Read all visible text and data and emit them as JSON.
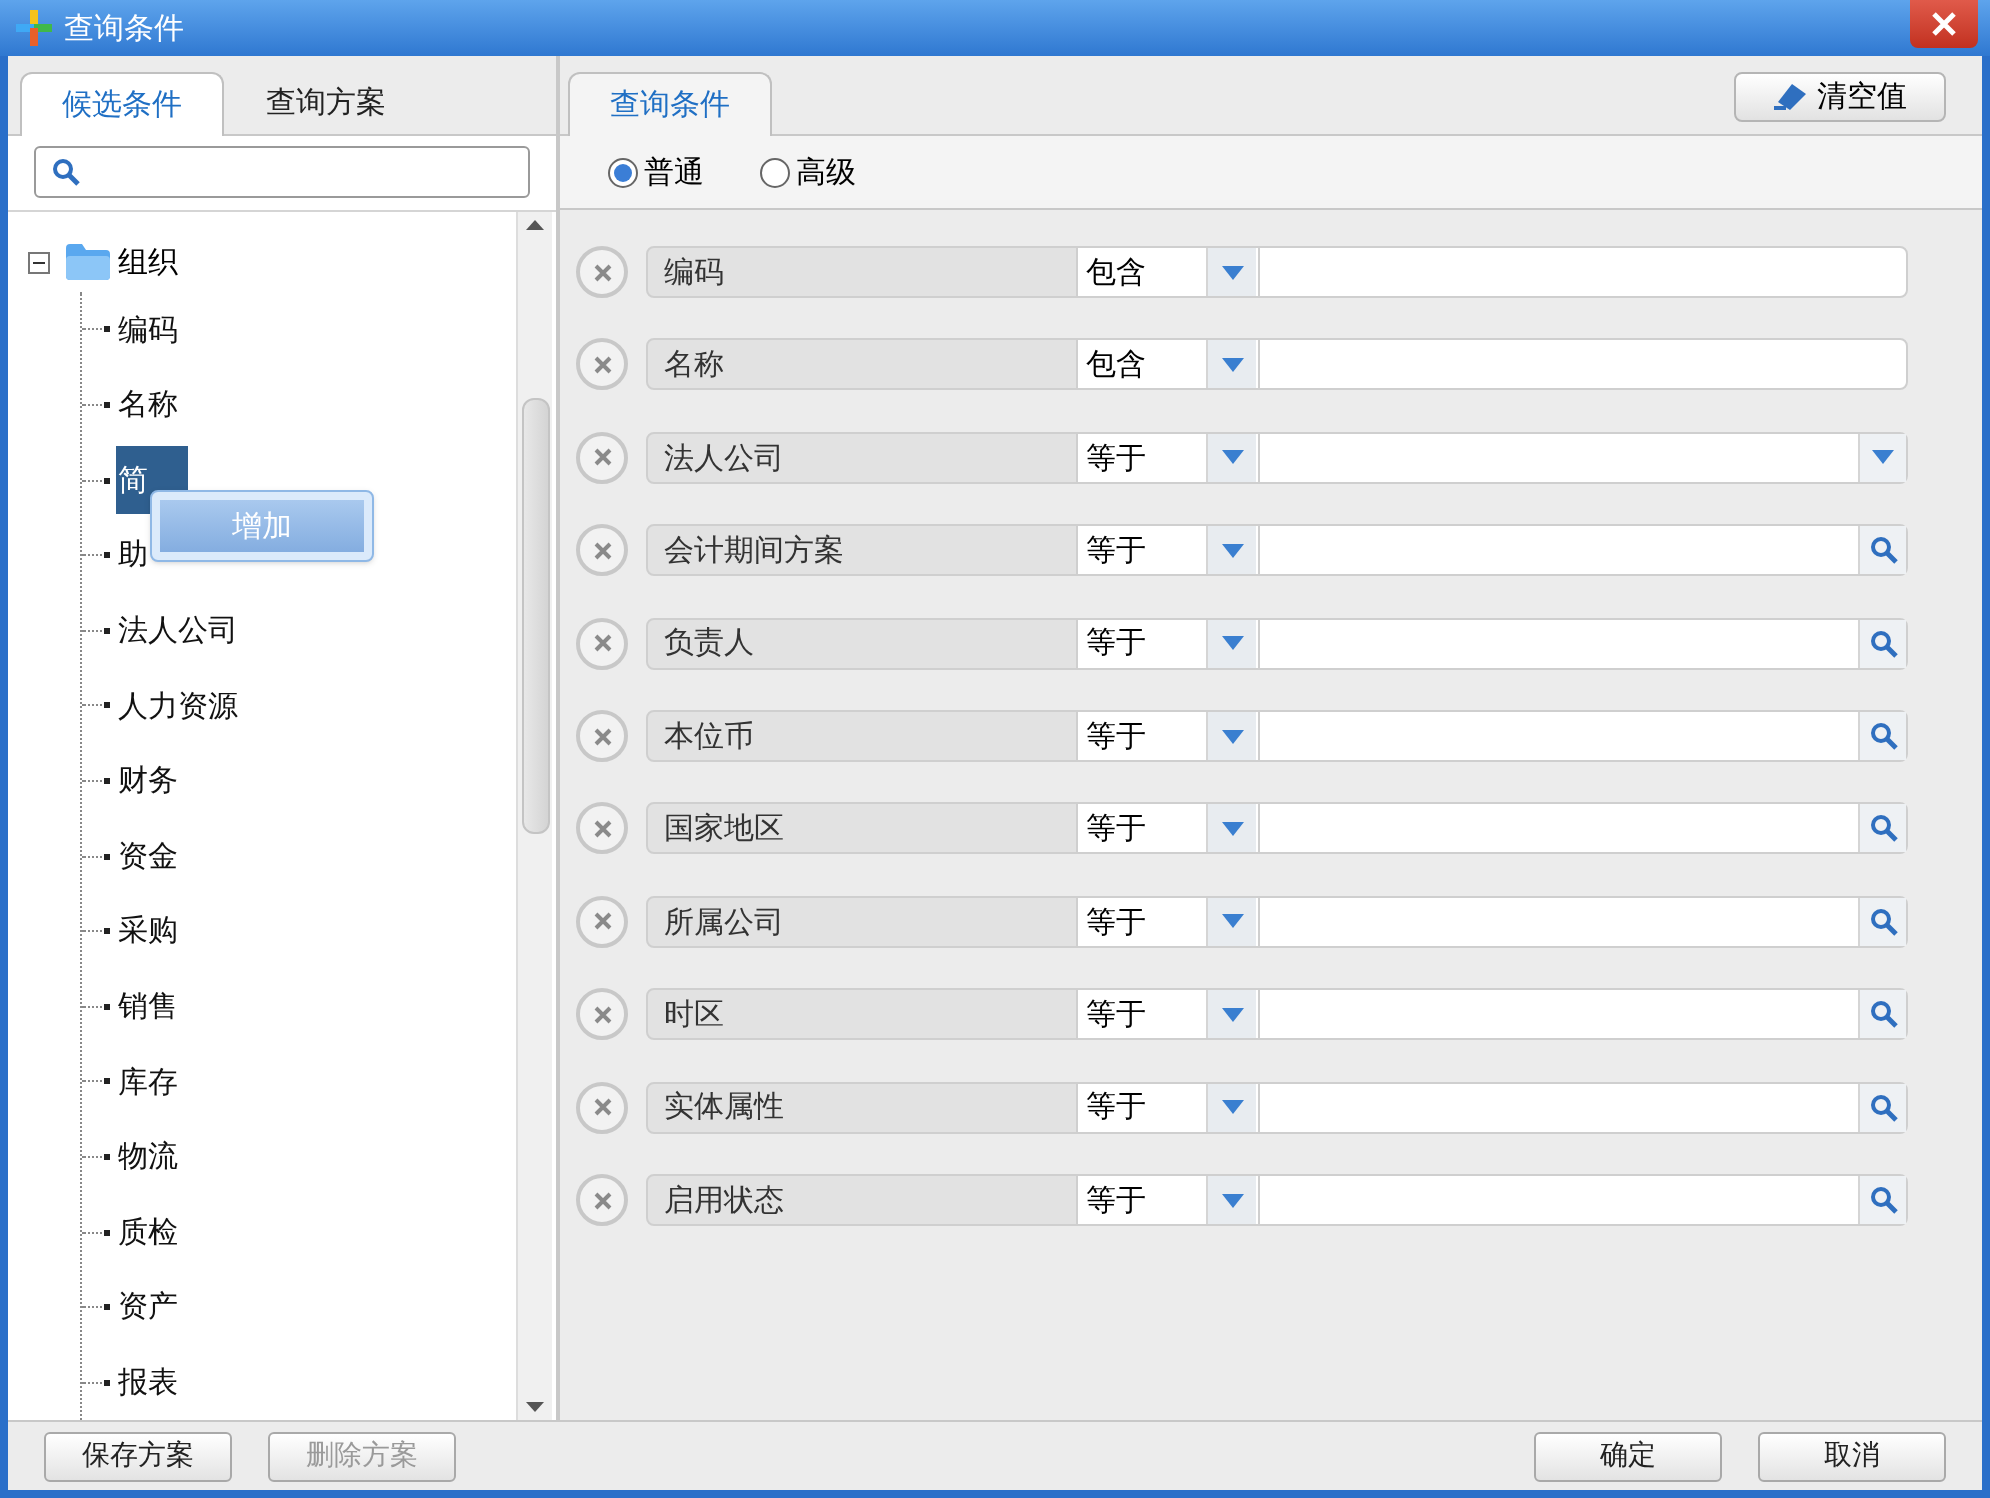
{
  "window": {
    "title": "查询条件"
  },
  "left_tabs": [
    {
      "label": "候选条件",
      "selected": true
    },
    {
      "label": "查询方案",
      "selected": false
    }
  ],
  "tree": {
    "label": "组织",
    "expanded": true,
    "children": [
      {
        "label": "编码",
        "selected": false
      },
      {
        "label": "名称",
        "selected": false
      },
      {
        "label": "简",
        "selected": true
      },
      {
        "label": "助",
        "selected": false
      },
      {
        "label": "法人公司",
        "selected": false
      },
      {
        "label": "人力资源",
        "selected": false
      },
      {
        "label": "财务",
        "selected": false
      },
      {
        "label": "资金",
        "selected": false
      },
      {
        "label": "采购",
        "selected": false
      },
      {
        "label": "销售",
        "selected": false
      },
      {
        "label": "库存",
        "selected": false
      },
      {
        "label": "物流",
        "selected": false
      },
      {
        "label": "质检",
        "selected": false
      },
      {
        "label": "资产",
        "selected": false
      },
      {
        "label": "报表",
        "selected": false
      }
    ]
  },
  "context_menu": {
    "items": [
      "增加"
    ]
  },
  "right_tab": {
    "label": "查询条件",
    "selected": true
  },
  "clear_button": "清空值",
  "modes": [
    {
      "label": "普通",
      "selected": true
    },
    {
      "label": "高级",
      "selected": false
    }
  ],
  "conditions": [
    {
      "field": "编码",
      "operator": "包含",
      "kind": "text"
    },
    {
      "field": "名称",
      "operator": "包含",
      "kind": "text"
    },
    {
      "field": "法人公司",
      "operator": "等于",
      "kind": "dropdown"
    },
    {
      "field": "会计期间方案",
      "operator": "等于",
      "kind": "lookup"
    },
    {
      "field": "负责人",
      "operator": "等于",
      "kind": "lookup"
    },
    {
      "field": "本位币",
      "operator": "等于",
      "kind": "lookup"
    },
    {
      "field": "国家地区",
      "operator": "等于",
      "kind": "lookup"
    },
    {
      "field": "所属公司",
      "operator": "等于",
      "kind": "lookup"
    },
    {
      "field": "时区",
      "operator": "等于",
      "kind": "lookup"
    },
    {
      "field": "实体属性",
      "operator": "等于",
      "kind": "lookup"
    },
    {
      "field": "启用状态",
      "operator": "等于",
      "kind": "lookup"
    }
  ],
  "footer_buttons": [
    {
      "label": "保存方案",
      "disabled": false
    },
    {
      "label": "删除方案",
      "disabled": true
    },
    {
      "label": "确定",
      "disabled": false
    },
    {
      "label": "取消",
      "disabled": false
    }
  ]
}
